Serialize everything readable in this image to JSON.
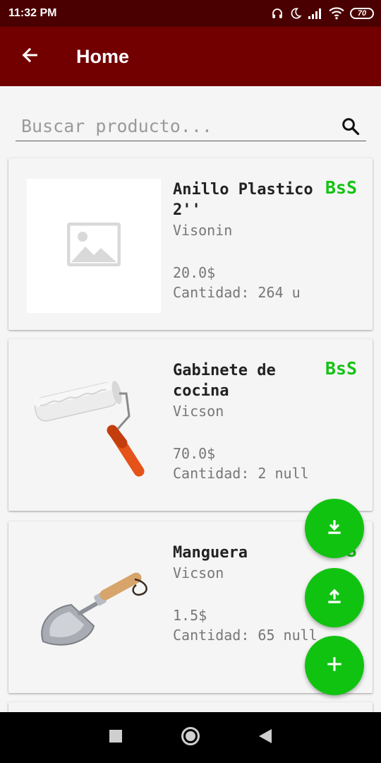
{
  "status_bar": {
    "time": "11:32 PM",
    "battery": "70",
    "icons": [
      "headphones-icon",
      "moon-icon",
      "signal-icon",
      "wifi-icon",
      "battery-icon"
    ]
  },
  "app_bar": {
    "title": "Home",
    "back_icon": "arrow-back-icon",
    "background": "#730000"
  },
  "search": {
    "placeholder": "Buscar producto...",
    "value": "",
    "icon": "search-icon"
  },
  "products": [
    {
      "name": "Anillo Plastico 2''",
      "brand": "Visonin",
      "price": "20.0$",
      "quantity": "Cantidad: 264 u",
      "currency": "BsS",
      "image": "image-placeholder-icon"
    },
    {
      "name": "Gabinete de cocina",
      "brand": "Vicson",
      "price": "70.0$",
      "quantity": "Cantidad: 2 null",
      "currency": "BsS",
      "image": "paint-roller-icon"
    },
    {
      "name": "Manguera",
      "brand": "Vicson",
      "price": "1.5$",
      "quantity": "Cantidad: 65 null",
      "currency": "BsS",
      "image": "garden-trowel-icon"
    }
  ],
  "fabs": [
    {
      "action": "download",
      "icon": "download-icon"
    },
    {
      "action": "upload",
      "icon": "upload-icon"
    },
    {
      "action": "add",
      "icon": "plus-icon"
    }
  ],
  "nav_bar": {
    "buttons": [
      "recents-square-icon",
      "home-circle-icon",
      "back-triangle-icon"
    ]
  },
  "colors": {
    "accent_green": "#11c311",
    "status_bar": "#4a0000",
    "app_bar": "#730000"
  }
}
